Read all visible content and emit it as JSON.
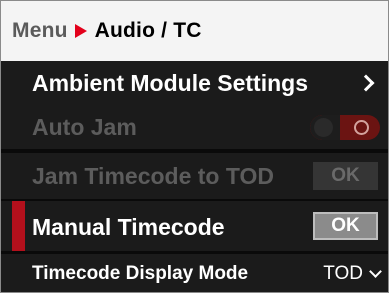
{
  "header": {
    "root": "Menu",
    "current": "Audio / TC"
  },
  "items": [
    {
      "label": "Ambient Module Settings",
      "control": "submenu",
      "enabled": true
    },
    {
      "label": "Auto Jam",
      "control": "toggle",
      "enabled": false,
      "state": "on"
    },
    {
      "label": "Jam Timecode to TOD",
      "control": "button",
      "button_label": "OK",
      "enabled": false
    },
    {
      "label": "Manual Timecode",
      "control": "button",
      "button_label": "OK",
      "enabled": true,
      "selected": true
    },
    {
      "label": "Timecode Display Mode",
      "control": "dropdown",
      "value": "TOD",
      "enabled": true
    }
  ],
  "colors": {
    "accent": "#e3001b",
    "selection_marker": "#b3101c",
    "background": "#1b1b1b",
    "header_bg": "#f4f4f4",
    "disabled_text": "#5c5c5c"
  },
  "icons": {
    "breadcrumb_separator": "chevron-right-icon",
    "submenu": "chevron-right-icon",
    "dropdown": "chevron-down-icon"
  }
}
